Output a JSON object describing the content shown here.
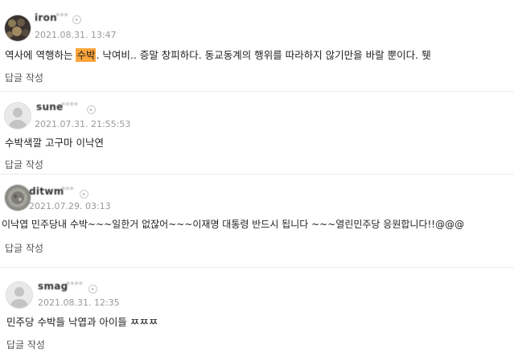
{
  "comments": [
    {
      "nickname": "iron",
      "nickname_mask": "***",
      "date": "2021.08.31. 13:47",
      "text_before": "역사에 역행하는 ",
      "highlight": "수박",
      "text_after": ". 낙여비.. 증말 창피하다. 동교동계의 행위를 따라하지 않기만을 바랄 뿐이다. 퉷",
      "reply_label": "답글 작성"
    },
    {
      "nickname": "sune",
      "nickname_mask": "****",
      "date": "2021.07.31. 21:55:53",
      "text": "수박색깔 고구마 이낙연",
      "reply_label": "답글 작성"
    },
    {
      "nickname": "ditwm",
      "nickname_mask": "***",
      "date": "2021.07.29. 03:13",
      "text": "이낙엽 민주당내 수박~~~일한거 없잖어~~~이재명 대통령 반드시 됩니다 ~~~열린민주당 응원합니다!!@@@",
      "reply_label": "답글 작성"
    },
    {
      "nickname": "smag",
      "nickname_mask": "****",
      "date": "2021.08.31. 12:35",
      "text": "민주당 수박들 낙엽과 아이들 ㅉㅉㅉ",
      "reply_label": "답글 작성"
    }
  ]
}
